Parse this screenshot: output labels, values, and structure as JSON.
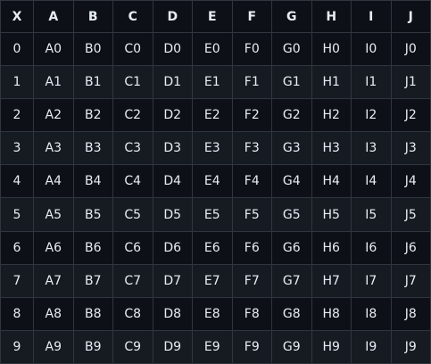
{
  "table": {
    "headers": [
      "X",
      "A",
      "B",
      "C",
      "D",
      "E",
      "F",
      "G",
      "H",
      "I",
      "J"
    ],
    "rows": [
      [
        "0",
        "A0",
        "B0",
        "C0",
        "D0",
        "E0",
        "F0",
        "G0",
        "H0",
        "I0",
        "J0"
      ],
      [
        "1",
        "A1",
        "B1",
        "C1",
        "D1",
        "E1",
        "F1",
        "G1",
        "H1",
        "I1",
        "J1"
      ],
      [
        "2",
        "A2",
        "B2",
        "C2",
        "D2",
        "E2",
        "F2",
        "G2",
        "H2",
        "I2",
        "J2"
      ],
      [
        "3",
        "A3",
        "B3",
        "C3",
        "D3",
        "E3",
        "F3",
        "G3",
        "H3",
        "I3",
        "J3"
      ],
      [
        "4",
        "A4",
        "B4",
        "C4",
        "D4",
        "E4",
        "F4",
        "G4",
        "H4",
        "I4",
        "J4"
      ],
      [
        "5",
        "A5",
        "B5",
        "C5",
        "D5",
        "E5",
        "F5",
        "G5",
        "H5",
        "I5",
        "J5"
      ],
      [
        "6",
        "A6",
        "B6",
        "C6",
        "D6",
        "E6",
        "F6",
        "G6",
        "H6",
        "I6",
        "J6"
      ],
      [
        "7",
        "A7",
        "B7",
        "C7",
        "D7",
        "E7",
        "F7",
        "G7",
        "H7",
        "I7",
        "J7"
      ],
      [
        "8",
        "A8",
        "B8",
        "C8",
        "D8",
        "E8",
        "F8",
        "G8",
        "H8",
        "I8",
        "J8"
      ],
      [
        "9",
        "A9",
        "B9",
        "C9",
        "D9",
        "E9",
        "F9",
        "G9",
        "H9",
        "I9",
        "J9"
      ]
    ]
  },
  "colors": {
    "background": "#0d1117",
    "row_alt": "#161b22",
    "border": "#30363d",
    "text": "#e6edf3"
  }
}
